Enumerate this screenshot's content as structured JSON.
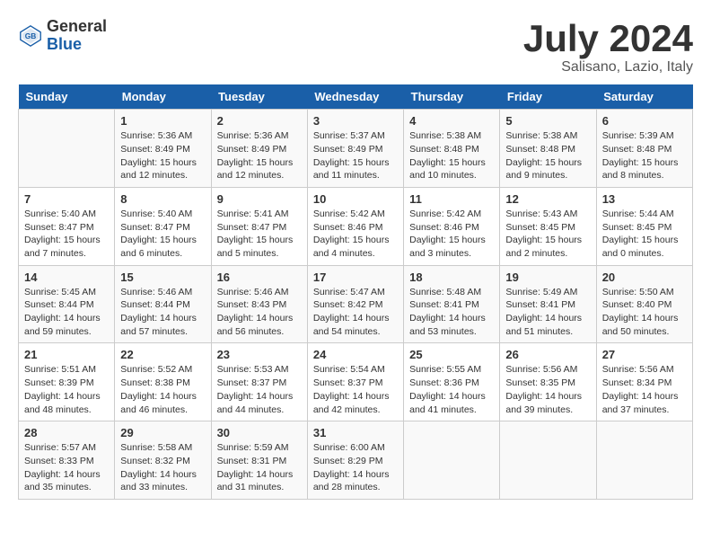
{
  "header": {
    "logo_general": "General",
    "logo_blue": "Blue",
    "month_title": "July 2024",
    "subtitle": "Salisano, Lazio, Italy"
  },
  "days_of_week": [
    "Sunday",
    "Monday",
    "Tuesday",
    "Wednesday",
    "Thursday",
    "Friday",
    "Saturday"
  ],
  "weeks": [
    [
      {
        "day": "",
        "sunrise": "",
        "sunset": "",
        "daylight": ""
      },
      {
        "day": "1",
        "sunrise": "Sunrise: 5:36 AM",
        "sunset": "Sunset: 8:49 PM",
        "daylight": "Daylight: 15 hours and 12 minutes."
      },
      {
        "day": "2",
        "sunrise": "Sunrise: 5:36 AM",
        "sunset": "Sunset: 8:49 PM",
        "daylight": "Daylight: 15 hours and 12 minutes."
      },
      {
        "day": "3",
        "sunrise": "Sunrise: 5:37 AM",
        "sunset": "Sunset: 8:49 PM",
        "daylight": "Daylight: 15 hours and 11 minutes."
      },
      {
        "day": "4",
        "sunrise": "Sunrise: 5:38 AM",
        "sunset": "Sunset: 8:48 PM",
        "daylight": "Daylight: 15 hours and 10 minutes."
      },
      {
        "day": "5",
        "sunrise": "Sunrise: 5:38 AM",
        "sunset": "Sunset: 8:48 PM",
        "daylight": "Daylight: 15 hours and 9 minutes."
      },
      {
        "day": "6",
        "sunrise": "Sunrise: 5:39 AM",
        "sunset": "Sunset: 8:48 PM",
        "daylight": "Daylight: 15 hours and 8 minutes."
      }
    ],
    [
      {
        "day": "7",
        "sunrise": "Sunrise: 5:40 AM",
        "sunset": "Sunset: 8:47 PM",
        "daylight": "Daylight: 15 hours and 7 minutes."
      },
      {
        "day": "8",
        "sunrise": "Sunrise: 5:40 AM",
        "sunset": "Sunset: 8:47 PM",
        "daylight": "Daylight: 15 hours and 6 minutes."
      },
      {
        "day": "9",
        "sunrise": "Sunrise: 5:41 AM",
        "sunset": "Sunset: 8:47 PM",
        "daylight": "Daylight: 15 hours and 5 minutes."
      },
      {
        "day": "10",
        "sunrise": "Sunrise: 5:42 AM",
        "sunset": "Sunset: 8:46 PM",
        "daylight": "Daylight: 15 hours and 4 minutes."
      },
      {
        "day": "11",
        "sunrise": "Sunrise: 5:42 AM",
        "sunset": "Sunset: 8:46 PM",
        "daylight": "Daylight: 15 hours and 3 minutes."
      },
      {
        "day": "12",
        "sunrise": "Sunrise: 5:43 AM",
        "sunset": "Sunset: 8:45 PM",
        "daylight": "Daylight: 15 hours and 2 minutes."
      },
      {
        "day": "13",
        "sunrise": "Sunrise: 5:44 AM",
        "sunset": "Sunset: 8:45 PM",
        "daylight": "Daylight: 15 hours and 0 minutes."
      }
    ],
    [
      {
        "day": "14",
        "sunrise": "Sunrise: 5:45 AM",
        "sunset": "Sunset: 8:44 PM",
        "daylight": "Daylight: 14 hours and 59 minutes."
      },
      {
        "day": "15",
        "sunrise": "Sunrise: 5:46 AM",
        "sunset": "Sunset: 8:44 PM",
        "daylight": "Daylight: 14 hours and 57 minutes."
      },
      {
        "day": "16",
        "sunrise": "Sunrise: 5:46 AM",
        "sunset": "Sunset: 8:43 PM",
        "daylight": "Daylight: 14 hours and 56 minutes."
      },
      {
        "day": "17",
        "sunrise": "Sunrise: 5:47 AM",
        "sunset": "Sunset: 8:42 PM",
        "daylight": "Daylight: 14 hours and 54 minutes."
      },
      {
        "day": "18",
        "sunrise": "Sunrise: 5:48 AM",
        "sunset": "Sunset: 8:41 PM",
        "daylight": "Daylight: 14 hours and 53 minutes."
      },
      {
        "day": "19",
        "sunrise": "Sunrise: 5:49 AM",
        "sunset": "Sunset: 8:41 PM",
        "daylight": "Daylight: 14 hours and 51 minutes."
      },
      {
        "day": "20",
        "sunrise": "Sunrise: 5:50 AM",
        "sunset": "Sunset: 8:40 PM",
        "daylight": "Daylight: 14 hours and 50 minutes."
      }
    ],
    [
      {
        "day": "21",
        "sunrise": "Sunrise: 5:51 AM",
        "sunset": "Sunset: 8:39 PM",
        "daylight": "Daylight: 14 hours and 48 minutes."
      },
      {
        "day": "22",
        "sunrise": "Sunrise: 5:52 AM",
        "sunset": "Sunset: 8:38 PM",
        "daylight": "Daylight: 14 hours and 46 minutes."
      },
      {
        "day": "23",
        "sunrise": "Sunrise: 5:53 AM",
        "sunset": "Sunset: 8:37 PM",
        "daylight": "Daylight: 14 hours and 44 minutes."
      },
      {
        "day": "24",
        "sunrise": "Sunrise: 5:54 AM",
        "sunset": "Sunset: 8:37 PM",
        "daylight": "Daylight: 14 hours and 42 minutes."
      },
      {
        "day": "25",
        "sunrise": "Sunrise: 5:55 AM",
        "sunset": "Sunset: 8:36 PM",
        "daylight": "Daylight: 14 hours and 41 minutes."
      },
      {
        "day": "26",
        "sunrise": "Sunrise: 5:56 AM",
        "sunset": "Sunset: 8:35 PM",
        "daylight": "Daylight: 14 hours and 39 minutes."
      },
      {
        "day": "27",
        "sunrise": "Sunrise: 5:56 AM",
        "sunset": "Sunset: 8:34 PM",
        "daylight": "Daylight: 14 hours and 37 minutes."
      }
    ],
    [
      {
        "day": "28",
        "sunrise": "Sunrise: 5:57 AM",
        "sunset": "Sunset: 8:33 PM",
        "daylight": "Daylight: 14 hours and 35 minutes."
      },
      {
        "day": "29",
        "sunrise": "Sunrise: 5:58 AM",
        "sunset": "Sunset: 8:32 PM",
        "daylight": "Daylight: 14 hours and 33 minutes."
      },
      {
        "day": "30",
        "sunrise": "Sunrise: 5:59 AM",
        "sunset": "Sunset: 8:31 PM",
        "daylight": "Daylight: 14 hours and 31 minutes."
      },
      {
        "day": "31",
        "sunrise": "Sunrise: 6:00 AM",
        "sunset": "Sunset: 8:29 PM",
        "daylight": "Daylight: 14 hours and 28 minutes."
      },
      {
        "day": "",
        "sunrise": "",
        "sunset": "",
        "daylight": ""
      },
      {
        "day": "",
        "sunrise": "",
        "sunset": "",
        "daylight": ""
      },
      {
        "day": "",
        "sunrise": "",
        "sunset": "",
        "daylight": ""
      }
    ]
  ]
}
